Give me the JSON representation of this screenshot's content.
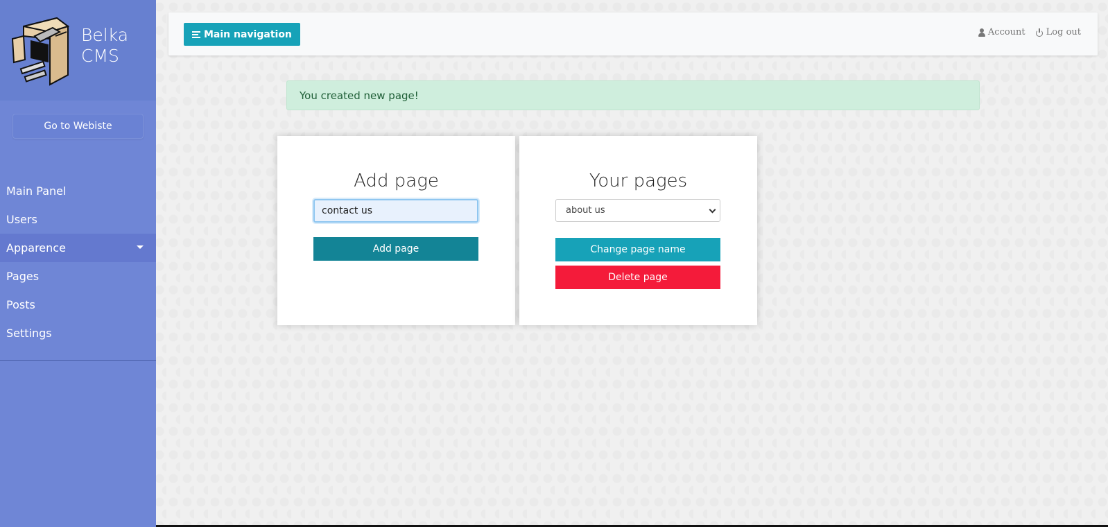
{
  "sidebar": {
    "brand_line1": "Belka",
    "brand_line2": "CMS",
    "go_website_label": "Go to Webiste",
    "items": [
      {
        "label": "Main Panel"
      },
      {
        "label": "Users"
      },
      {
        "label": "Apparence"
      },
      {
        "label": "Pages"
      },
      {
        "label": "Posts"
      },
      {
        "label": "Settings"
      }
    ],
    "active_item": "Apparence"
  },
  "topbar": {
    "main_nav_label": "Main navigation",
    "account_label": "Account",
    "logout_label": "Log out"
  },
  "alert": {
    "message": "You created new page!"
  },
  "add_page": {
    "title": "Add page",
    "input_value": "contact us",
    "button_label": "Add page"
  },
  "your_pages": {
    "title": "Your pages",
    "selected_page": "about us",
    "change_label": "Change page name",
    "delete_label": "Delete page"
  },
  "colors": {
    "sidebar": "#6f86d6",
    "brand_bg": "#6780d0",
    "accent": "#17a2b8",
    "accent_dark": "#138496",
    "danger": "#f41b3a",
    "alert_bg": "#cfeedd"
  },
  "icons": {
    "menu": "menu-lines-icon",
    "account": "user-icon",
    "logout": "power-icon",
    "dropdown": "chevron-down-icon",
    "caret": "caret-down-icon"
  }
}
